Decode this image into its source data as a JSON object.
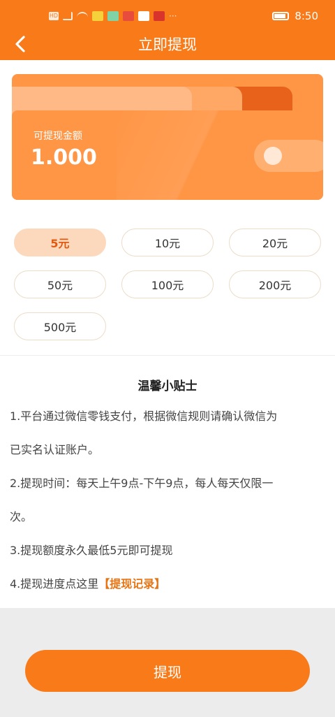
{
  "status_bar": {
    "time": "8:50"
  },
  "header": {
    "title": "立即提现",
    "back_icon": "chevron-left-icon"
  },
  "card": {
    "label": "可提现金额",
    "amount": "1.000"
  },
  "amount_options": [
    "5元",
    "10元",
    "20元",
    "50元",
    "100元",
    "200元",
    "500元"
  ],
  "selected_option": "5元",
  "tips": {
    "title": "温馨小贴士",
    "lines": [
      "1.平台通过微信零钱支付，根据微信规则请确认微信为",
      "已实名认证账户。",
      "2.提现时间：每天上午9点-下午9点，每人每天仅限一",
      "次。",
      "3.提现额度永久最低5元即可提现"
    ],
    "line4_prefix": "4.提现进度点这里",
    "line4_link": "【提现记录】"
  },
  "withdraw_button": "提现",
  "colors": {
    "brand": "#f97a19",
    "selected_bg": "#fcd9bd",
    "link": "#e77413"
  }
}
